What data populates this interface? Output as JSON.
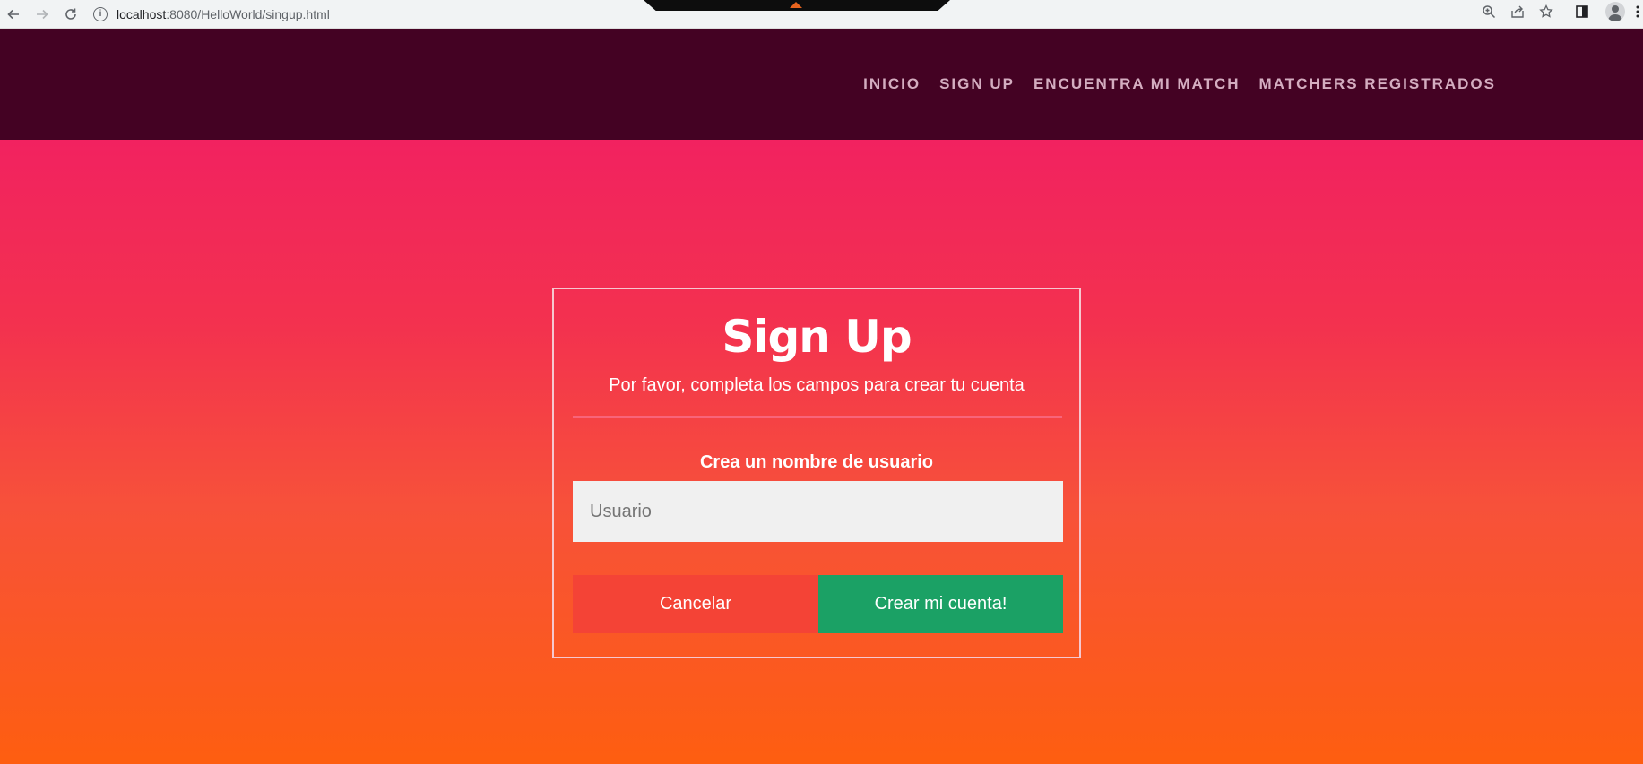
{
  "browser": {
    "url_host": "localhost",
    "url_path": ":8080/HelloWorld/singup.html"
  },
  "nav": {
    "items": [
      "INICIO",
      "SIGN UP",
      "ENCUENTRA MI MATCH",
      "MATCHERS REGISTRADOS"
    ]
  },
  "form": {
    "title": "Sign Up",
    "subtitle": "Por favor, completa los campos para crear tu cuenta",
    "username_label": "Crea un nombre de usuario",
    "username_placeholder": "Usuario",
    "username_value": "",
    "cancel_label": "Cancelar",
    "submit_label": "Crear mi cuenta!"
  },
  "colors": {
    "header_bg": "#440223",
    "gradient_top": "#f1196a",
    "gradient_bottom": "#fe5e10",
    "cancel_button": "#f44336",
    "submit_button": "#1ba165"
  }
}
